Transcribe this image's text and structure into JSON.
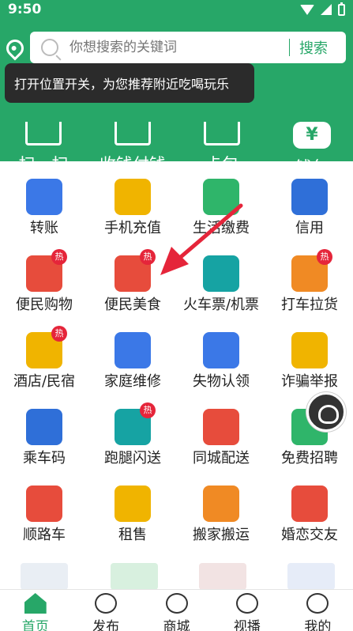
{
  "status": {
    "time": "9:50"
  },
  "search": {
    "placeholder": "你想搜索的关键词",
    "button": "搜索"
  },
  "tooltip": "打开位置开关，为您推荐附近吃喝玩乐",
  "quick_actions": [
    "扫一扫",
    "收钱付钱",
    "卡包",
    "钱包"
  ],
  "wallet_symbol": "¥",
  "services": [
    {
      "label": "转账",
      "icon": "transfer-icon",
      "color": "#3b78e7",
      "hot": false
    },
    {
      "label": "手机充值",
      "icon": "phone-recharge-icon",
      "color": "#f0b400",
      "hot": false
    },
    {
      "label": "生活缴费",
      "icon": "bill-payment-icon",
      "color": "#2fb56a",
      "hot": false
    },
    {
      "label": "信用",
      "icon": "credit-icon",
      "color": "#2f6fd8",
      "hot": false
    },
    {
      "label": "便民购物",
      "icon": "shopping-cart-icon",
      "color": "#e74c3c",
      "hot": true
    },
    {
      "label": "便民美食",
      "icon": "food-bowl-icon",
      "color": "#e74c3c",
      "hot": true
    },
    {
      "label": "火车票/机票",
      "icon": "train-plane-icon",
      "color": "#16a3a3",
      "hot": false
    },
    {
      "label": "打车拉货",
      "icon": "car-icon",
      "color": "#f08a24",
      "hot": true
    },
    {
      "label": "酒店/民宿",
      "icon": "hotel-icon",
      "color": "#f0b400",
      "hot": true
    },
    {
      "label": "家庭维修",
      "icon": "home-repair-icon",
      "color": "#3b78e7",
      "hot": false
    },
    {
      "label": "失物认领",
      "icon": "lost-found-icon",
      "color": "#3b78e7",
      "hot": false
    },
    {
      "label": "诈骗举报",
      "icon": "fraud-report-icon",
      "color": "#f0b400",
      "hot": false
    },
    {
      "label": "乘车码",
      "icon": "bus-code-icon",
      "color": "#2f6fd8",
      "hot": false
    },
    {
      "label": "跑腿闪送",
      "icon": "courier-icon",
      "color": "#16a3a3",
      "hot": true
    },
    {
      "label": "同城配送",
      "icon": "delivery-truck-icon",
      "color": "#e74c3c",
      "hot": false
    },
    {
      "label": "免费招聘",
      "icon": "recruit-icon",
      "color": "#2fb56a",
      "hot": false
    },
    {
      "label": "顺路车",
      "icon": "ride-share-icon",
      "color": "#e74c3c",
      "hot": false
    },
    {
      "label": "租售",
      "icon": "rent-icon",
      "color": "#f0b400",
      "hot": false
    },
    {
      "label": "搬家搬运",
      "icon": "moving-icon",
      "color": "#f08a24",
      "hot": false
    },
    {
      "label": "婚恋交友",
      "icon": "dating-icon",
      "color": "#e74c3c",
      "hot": false
    }
  ],
  "hot_badge": "热",
  "tabs": [
    {
      "label": "首页",
      "icon": "home-icon"
    },
    {
      "label": "发布",
      "icon": "publish-icon"
    },
    {
      "label": "商城",
      "icon": "mall-icon"
    },
    {
      "label": "视播",
      "icon": "video-icon"
    },
    {
      "label": "我的",
      "icon": "profile-icon"
    }
  ],
  "colors": {
    "brand": "#27a768",
    "hot": "#e5253a",
    "arrow": "#e5253a"
  }
}
